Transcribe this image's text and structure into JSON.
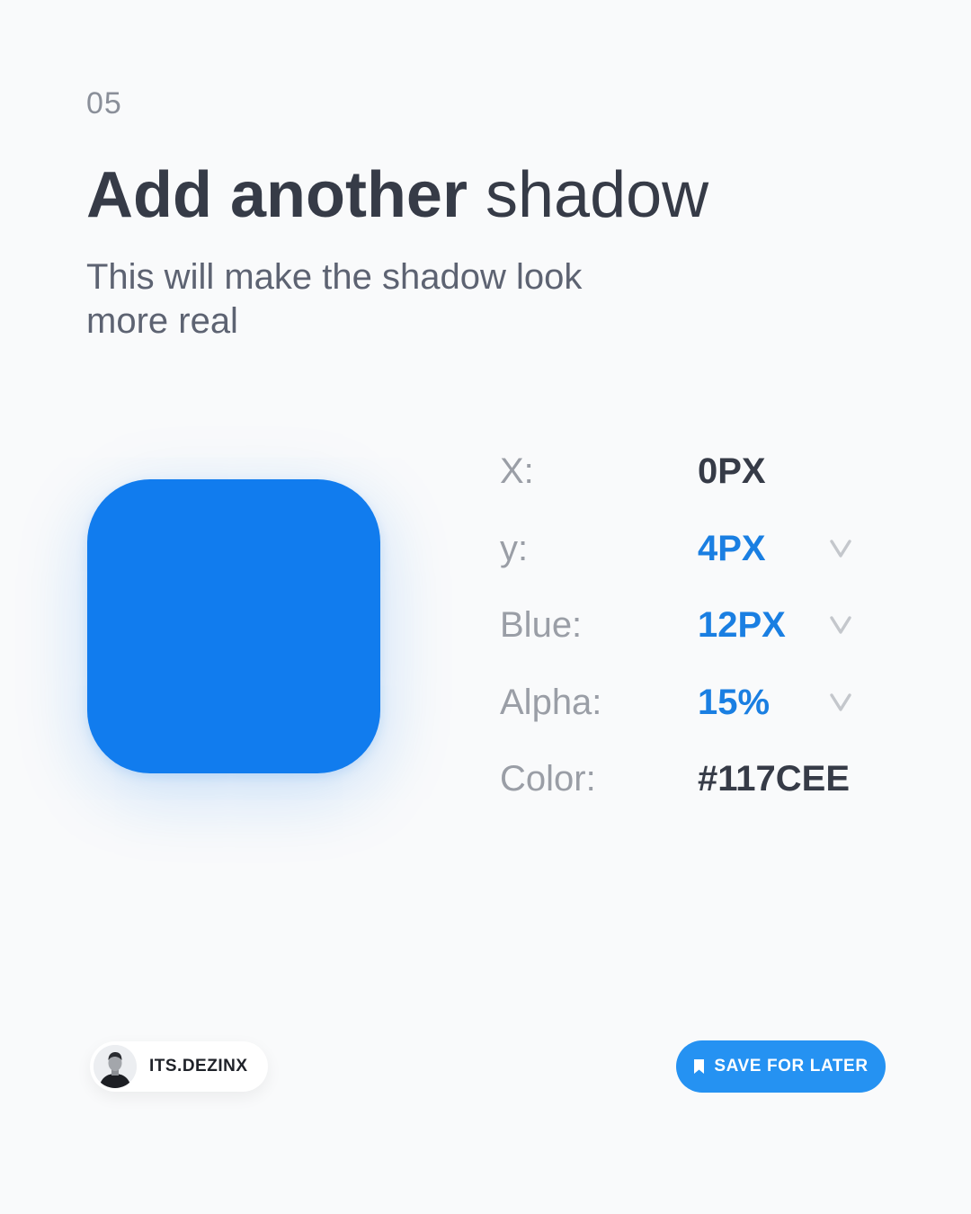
{
  "step": "05",
  "title": {
    "bold": "Add another",
    "light": " shadow"
  },
  "subtitle": "This will make the shadow look more real",
  "preview": {
    "color": "#117CEE"
  },
  "properties": [
    {
      "label": "X:",
      "value": "0PX",
      "editable": false
    },
    {
      "label": "y:",
      "value": "4PX",
      "editable": true
    },
    {
      "label": "Blue:",
      "value": "12PX",
      "editable": true
    },
    {
      "label": "Alpha:",
      "value": "15%",
      "editable": true
    },
    {
      "label": "Color:",
      "value": "#117CEE",
      "editable": false
    }
  ],
  "author": {
    "name": "ITS.DEZINX",
    "icon": "avatar"
  },
  "save_button": {
    "label": "SAVE FOR LATER",
    "icon": "bookmark-icon",
    "color": "#2592F2"
  },
  "colors": {
    "accent": "#1A7FE2",
    "background": "#F9FAFB",
    "heading": "#363B47"
  }
}
